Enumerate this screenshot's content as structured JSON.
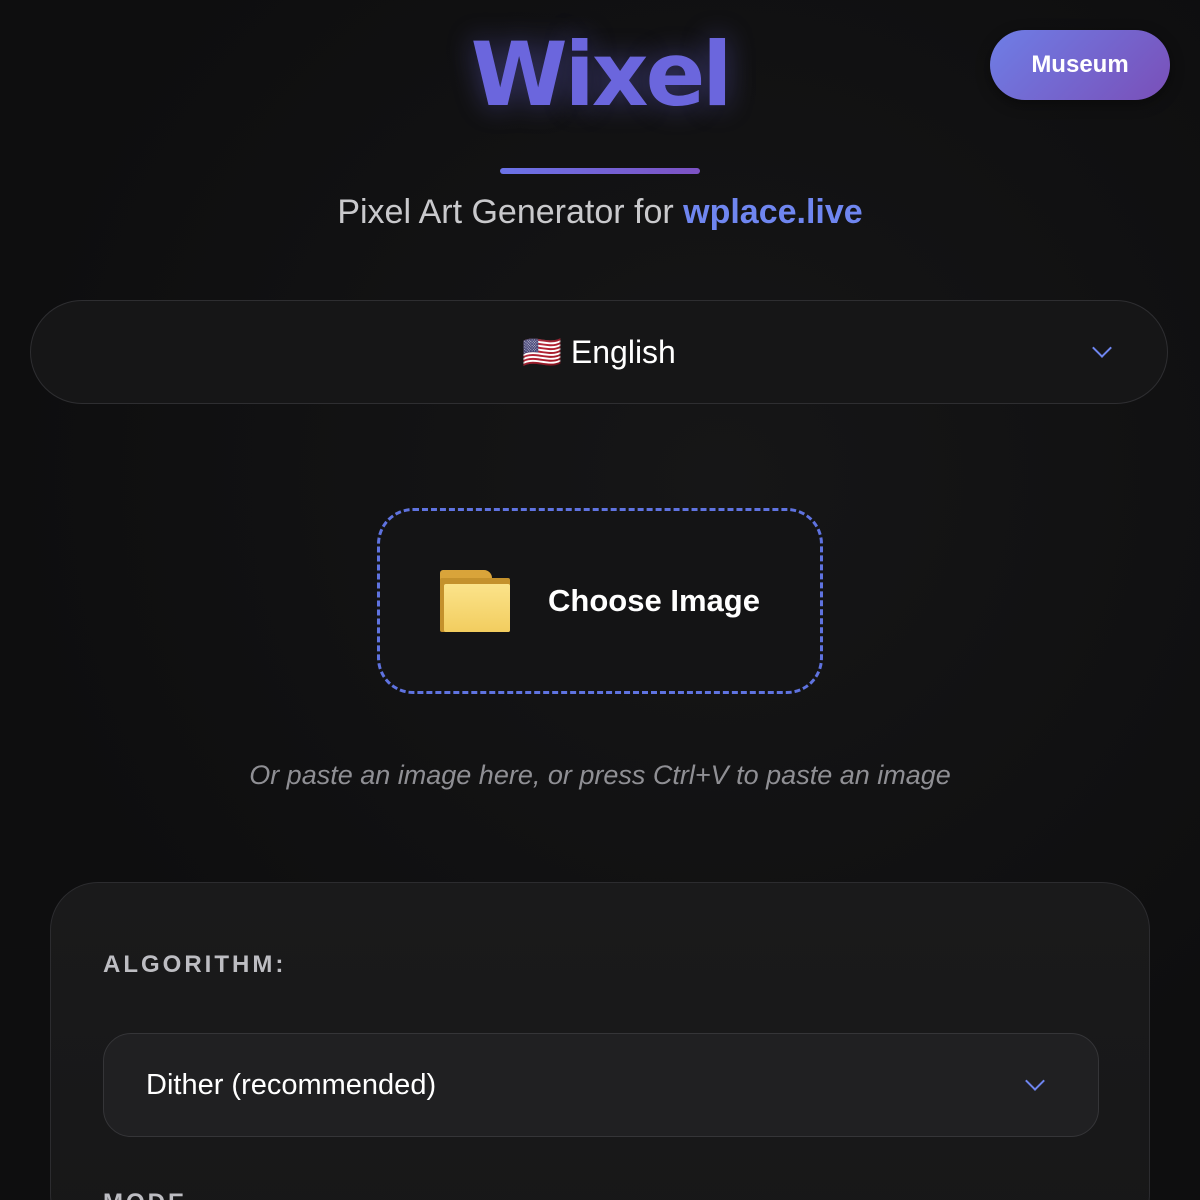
{
  "header": {
    "logo": "Wixel",
    "museum_label": "Museum",
    "subtitle_prefix": "Pixel Art Generator for ",
    "subtitle_link": "wplace.live"
  },
  "language": {
    "flag": "🇺🇸",
    "selected": "English"
  },
  "upload": {
    "label": "Choose Image",
    "hint": "Or paste an image here, or press Ctrl+V to paste an image"
  },
  "settings": {
    "algorithm_label": "ALGORITHM:",
    "algorithm_value": "Dither (recommended)",
    "mode_label": "MODE"
  },
  "colors": {
    "accent": "#6b66dd",
    "link": "#6f86f0",
    "dashed_border": "#5f73e0",
    "background": "#0e0e0f"
  },
  "icons": {
    "folder": "folder-icon",
    "chevron": "chevron-down-icon",
    "flag": "us-flag-icon"
  }
}
